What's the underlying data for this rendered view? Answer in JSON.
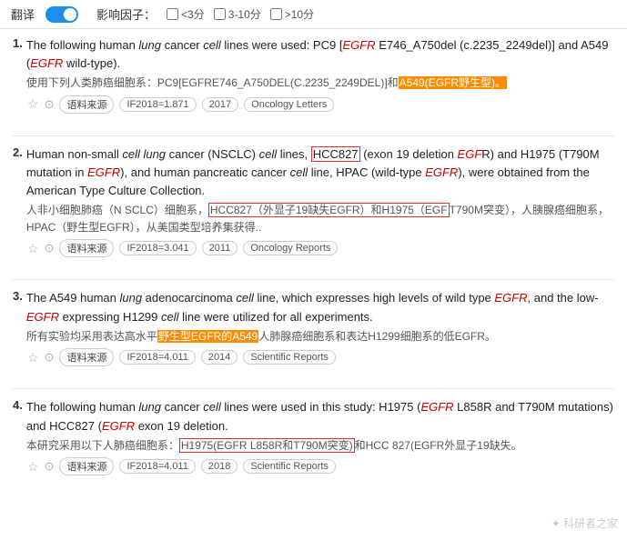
{
  "topbar": {
    "translate_label": "翻译",
    "toggle_state": "on",
    "filter_label": "影响因子：",
    "filters": [
      {
        "label": "<3分",
        "checked": false
      },
      {
        "label": "3-10分",
        "checked": false
      },
      {
        "label": ">10分",
        "checked": false
      }
    ]
  },
  "results": [
    {
      "number": "1.",
      "en_parts": [
        {
          "text": "The following human ",
          "style": "normal"
        },
        {
          "text": "lung",
          "style": "italic"
        },
        {
          "text": " cancer ",
          "style": "normal"
        },
        {
          "text": "cell",
          "style": "italic"
        },
        {
          "text": " lines were used: PC9 [",
          "style": "normal"
        },
        {
          "text": "EGFR",
          "style": "italic-red"
        },
        {
          "text": " E746_A750del (c.2235_2249del)] and A549 (",
          "style": "normal"
        },
        {
          "text": "EGFR",
          "style": "italic-red"
        },
        {
          "text": " wild-type).",
          "style": "normal"
        }
      ],
      "zh_parts": [
        {
          "text": "使用下列人类肺癌细胞系：PC9[EGFRE746_A750DEL(C.2235_2249DEL)]和",
          "style": "normal"
        },
        {
          "text": "A549(EGFR野生型)。",
          "style": "highlight-orange"
        }
      ],
      "meta": {
        "if_year": "IF2018=1.871",
        "pub_year": "2017",
        "journal": "Oncology Letters"
      }
    },
    {
      "number": "2.",
      "en_parts": [
        {
          "text": "Human non-small ",
          "style": "normal"
        },
        {
          "text": "cell lung",
          "style": "italic"
        },
        {
          "text": " cancer (NSCLC) ",
          "style": "normal"
        },
        {
          "text": "cell",
          "style": "italic"
        },
        {
          "text": " lines, ",
          "style": "normal"
        },
        {
          "text": "HCC827",
          "style": "highlight-red-border"
        },
        {
          "text": " (exon 19 deletion ",
          "style": "normal"
        },
        {
          "text": "EGF",
          "style": "italic-red"
        },
        {
          "text": "R) and H1975 (T790M mutation in ",
          "style": "normal"
        },
        {
          "text": "EGFR",
          "style": "italic-red"
        },
        {
          "text": "), and human pancreatic cancer ",
          "style": "normal"
        },
        {
          "text": "cell",
          "style": "italic"
        },
        {
          "text": " line, HPAC (wild-type ",
          "style": "normal"
        },
        {
          "text": "EGFR",
          "style": "italic-red"
        },
        {
          "text": "), were obtained from the American Type Culture Collection.",
          "style": "normal"
        }
      ],
      "zh_parts": [
        {
          "text": "人非小细胞肺癌（N SCLC）细胞系，",
          "style": "normal"
        },
        {
          "text": "HCC827（外显子19缺失EGFR）和H1975（EGF",
          "style": "highlight-red-border"
        },
        {
          "text": "T790M突变），人胰腺癌细胞系，HPAC（野生型EGFR），从美国类型培养集获得..",
          "style": "normal"
        }
      ],
      "meta": {
        "if_year": "IF2018=3.041",
        "pub_year": "2011",
        "journal": "Oncology Reports"
      }
    },
    {
      "number": "3.",
      "en_parts": [
        {
          "text": "The A549 human ",
          "style": "normal"
        },
        {
          "text": "lung",
          "style": "italic"
        },
        {
          "text": " adenocarcinoma ",
          "style": "normal"
        },
        {
          "text": "cell",
          "style": "italic"
        },
        {
          "text": " line, which expresses high levels of wild type ",
          "style": "normal"
        },
        {
          "text": "EGFR",
          "style": "italic-red"
        },
        {
          "text": ", and the low-",
          "style": "normal"
        },
        {
          "text": "EGFR",
          "style": "italic-red"
        },
        {
          "text": " expressing H1299 ",
          "style": "normal"
        },
        {
          "text": "cell",
          "style": "italic"
        },
        {
          "text": " line were utilized for all experiments.",
          "style": "normal"
        }
      ],
      "zh_parts": [
        {
          "text": "所有实验均采用表达高水平",
          "style": "normal"
        },
        {
          "text": "野生型EGFR的A549",
          "style": "highlight-orange"
        },
        {
          "text": "人肺腺癌细胞系和表达H1299细胞系的低EGFR。",
          "style": "normal"
        }
      ],
      "meta": {
        "if_year": "IF2018=4.011",
        "pub_year": "2014",
        "journal": "Scientific Reports"
      }
    },
    {
      "number": "4.",
      "en_parts": [
        {
          "text": "The following human ",
          "style": "normal"
        },
        {
          "text": "lung",
          "style": "italic"
        },
        {
          "text": " cancer ",
          "style": "normal"
        },
        {
          "text": "cell",
          "style": "italic"
        },
        {
          "text": " lines were used in this study: H1975 (",
          "style": "normal"
        },
        {
          "text": "EGFR",
          "style": "italic-red"
        },
        {
          "text": " L858R and T790M mutations) and HCC827 (",
          "style": "normal"
        },
        {
          "text": "EGFR",
          "style": "italic-red"
        },
        {
          "text": " exon 19 deletion.",
          "style": "normal"
        }
      ],
      "zh_parts": [
        {
          "text": "本研究采用以下人肺癌细胞系：",
          "style": "normal"
        },
        {
          "text": "H1975(EGFR L858R和T790M突变)",
          "style": "highlight-red-border"
        },
        {
          "text": "和HCC 827(EGFR外显子19缺失。",
          "style": "normal"
        }
      ],
      "meta": {
        "if_year": "IF2018=4.011",
        "pub_year": "2018",
        "journal": "Scientific Reports"
      }
    }
  ],
  "watermark": "✦ 科研者之家"
}
